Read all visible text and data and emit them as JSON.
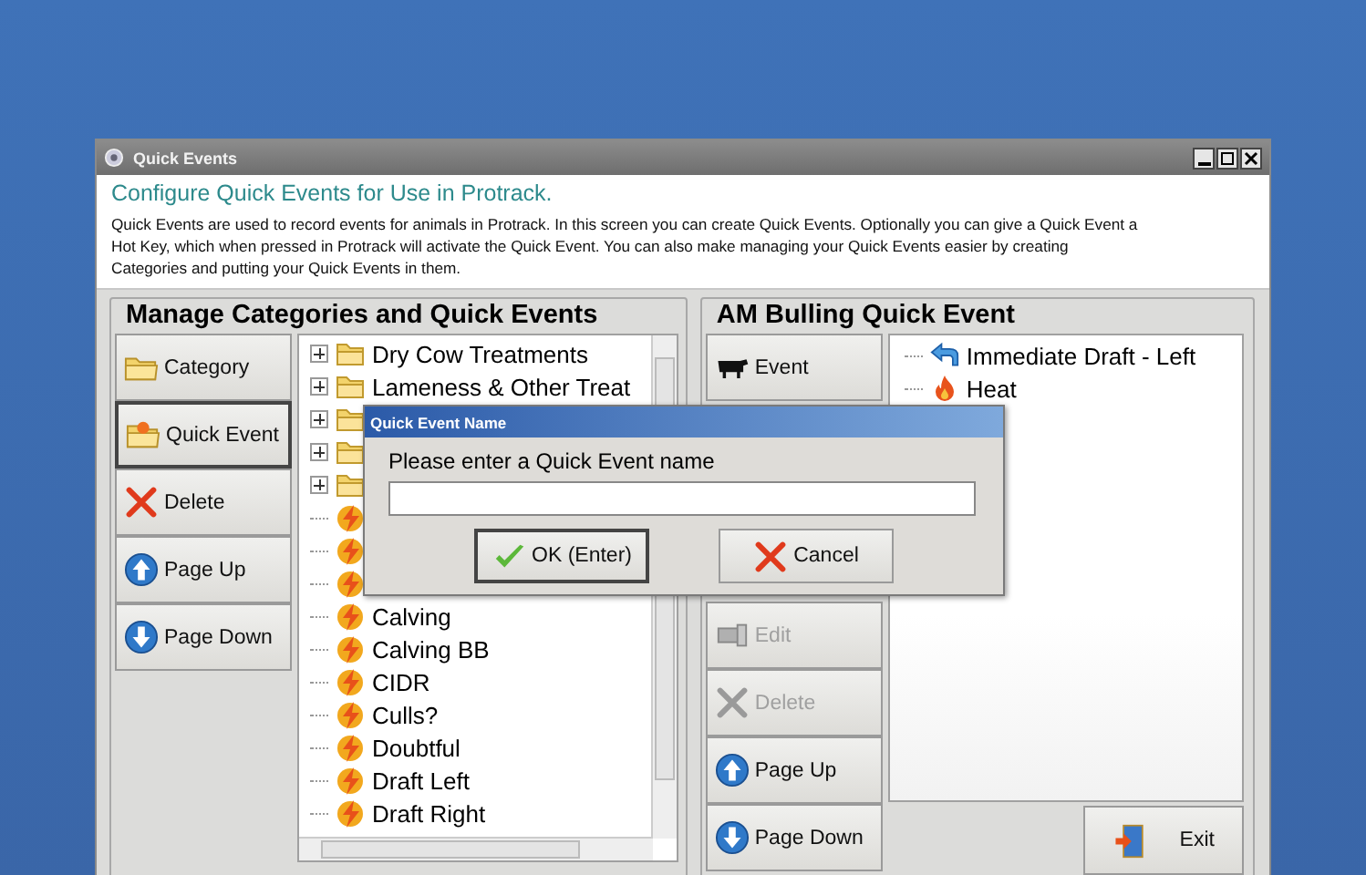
{
  "window": {
    "title": "Quick Events"
  },
  "header": {
    "heading": "Configure Quick Events for Use in Protrack.",
    "description": "Quick Events are used to record events for animals in Protrack. In this screen you can create Quick Events. Optionally you can give a Quick Event a Hot Key, which when pressed in Protrack will activate the Quick Event. You can also make managing your Quick Events easier by creating Categories and putting your Quick Events in them."
  },
  "categories_panel": {
    "title": "Manage Categories and Quick Events",
    "buttons": [
      {
        "kind": "folder",
        "label": "Category",
        "selected": false
      },
      {
        "kind": "event-folder",
        "label": "Quick Event",
        "selected": true
      },
      {
        "kind": "delete",
        "label": "Delete",
        "selected": false
      },
      {
        "kind": "page-up",
        "label": "Page Up",
        "selected": false
      },
      {
        "kind": "page-down",
        "label": "Page Down",
        "selected": false
      }
    ],
    "tree": [
      {
        "kind": "category",
        "label": "Dry Cow Treatments"
      },
      {
        "kind": "category",
        "label": "Lameness & Other Treat"
      },
      {
        "kind": "category"
      },
      {
        "kind": "category"
      },
      {
        "kind": "category"
      },
      {
        "kind": "event"
      },
      {
        "kind": "event"
      },
      {
        "kind": "event"
      },
      {
        "kind": "event",
        "label": "Calving"
      },
      {
        "kind": "event",
        "label": "Calving BB"
      },
      {
        "kind": "event",
        "label": "CIDR"
      },
      {
        "kind": "event",
        "label": "Culls?"
      },
      {
        "kind": "event",
        "label": "Doubtful"
      },
      {
        "kind": "event",
        "label": "Draft Left"
      },
      {
        "kind": "event",
        "label": "Draft Right"
      }
    ]
  },
  "quick_event_panel": {
    "title": "AM Bulling Quick Event",
    "buttons": [
      {
        "kind": "cow",
        "label": "Event",
        "disabled": false
      },
      {
        "kind": "edit",
        "label": "Edit",
        "disabled": true
      },
      {
        "kind": "delete",
        "label": "Delete",
        "disabled": true
      },
      {
        "kind": "page-up",
        "label": "Page Up",
        "disabled": false
      },
      {
        "kind": "page-down",
        "label": "Page Down",
        "disabled": false
      }
    ],
    "events": [
      {
        "kind": "draft",
        "label": "Immediate Draft - Left"
      },
      {
        "kind": "heat",
        "label": "Heat"
      }
    ],
    "exit_button": "Exit"
  },
  "dialog": {
    "title": "Quick Event Name",
    "prompt": "Please enter a Quick Event name",
    "ok_button": "OK (Enter)",
    "cancel_button": "Cancel"
  }
}
